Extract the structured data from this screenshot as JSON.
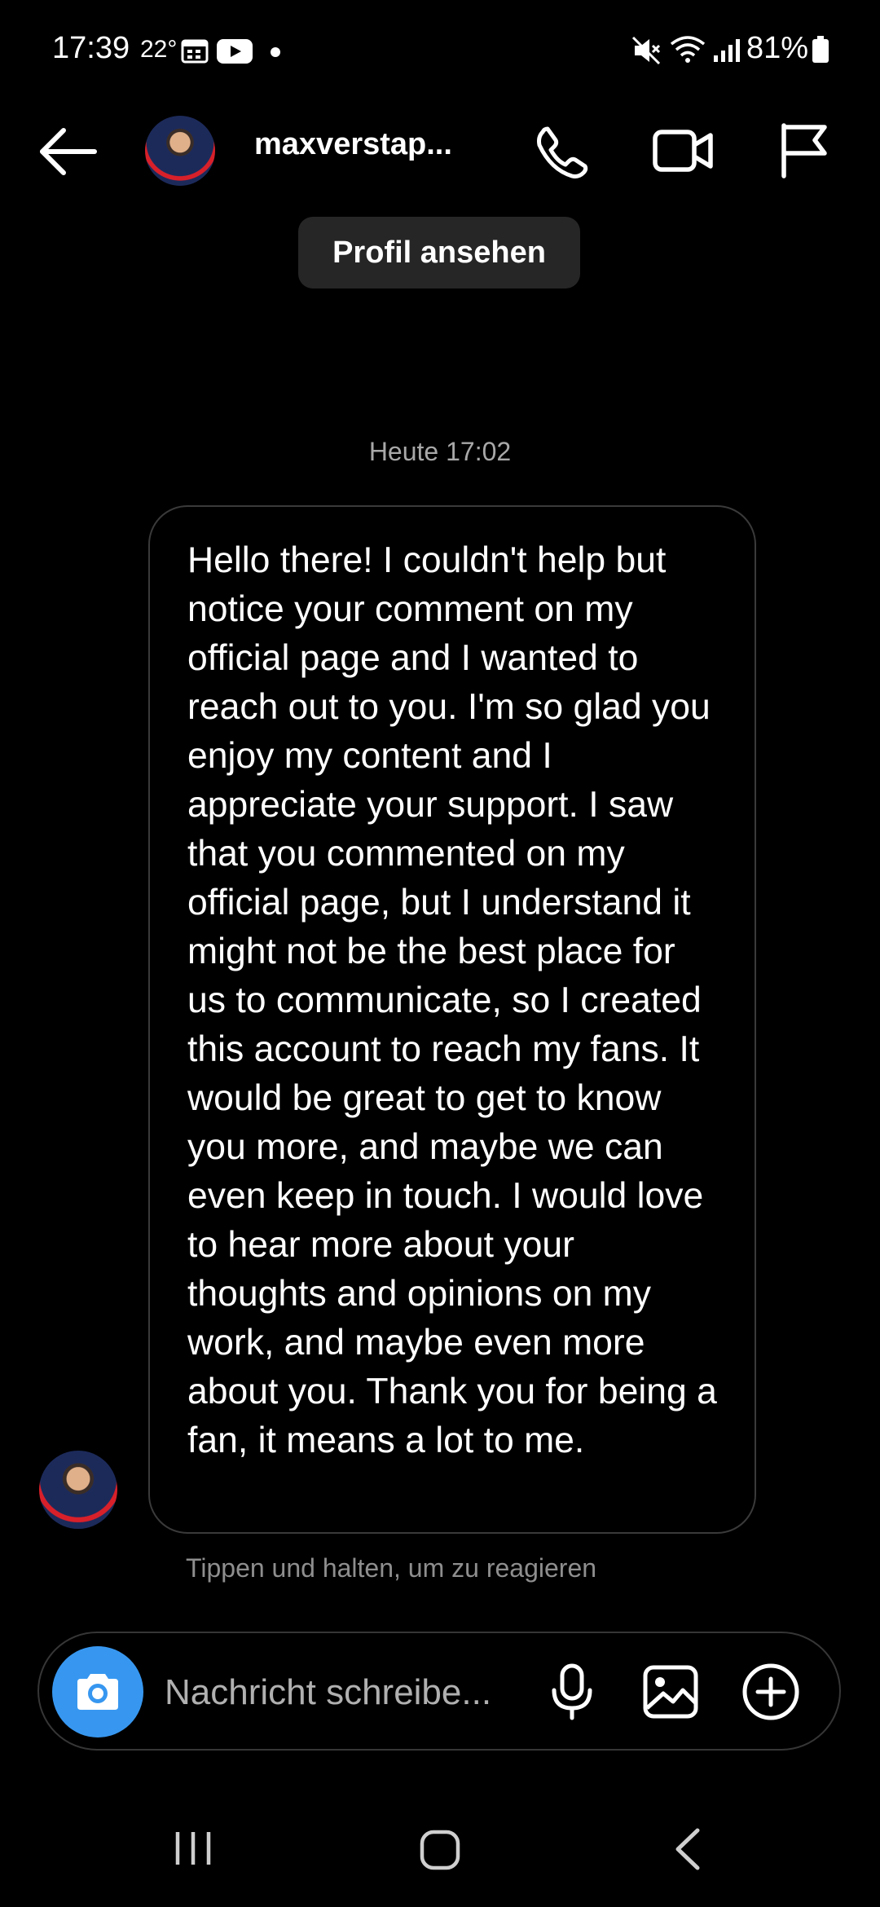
{
  "status_bar": {
    "time": "17:39",
    "temperature": "22°",
    "battery": "81%"
  },
  "header": {
    "username": "maxverstap...",
    "icons": [
      "arrow-left-icon",
      "phone-icon",
      "video-camera-icon",
      "flag-icon"
    ]
  },
  "view_profile_label": "Profil ansehen",
  "chat": {
    "timestamp": "Heute 17:02",
    "message": "Hello there! I couldn't help but notice your comment on my official page and I wanted to reach out to you. I'm so glad you enjoy my content and I appreciate your support. I saw that you commented on my official page, but I understand it might not be the best place for us to communicate, so I created this account to reach my fans. It would be great to get to know you more, and maybe we can even keep in touch. I would love to hear more about your thoughts and opinions on my work, and maybe even more about you. Thank you for being a fan, it means a lot to me.",
    "hint": "Tippen und halten, um zu reagieren"
  },
  "composer": {
    "placeholder": "Nachricht schreibe...",
    "icons": [
      "camera-icon",
      "microphone-icon",
      "gallery-icon",
      "plus-circle-icon"
    ]
  },
  "colors": {
    "background": "#000000",
    "accent": "#3797f0",
    "secondary_text": "#a8a8a8"
  }
}
